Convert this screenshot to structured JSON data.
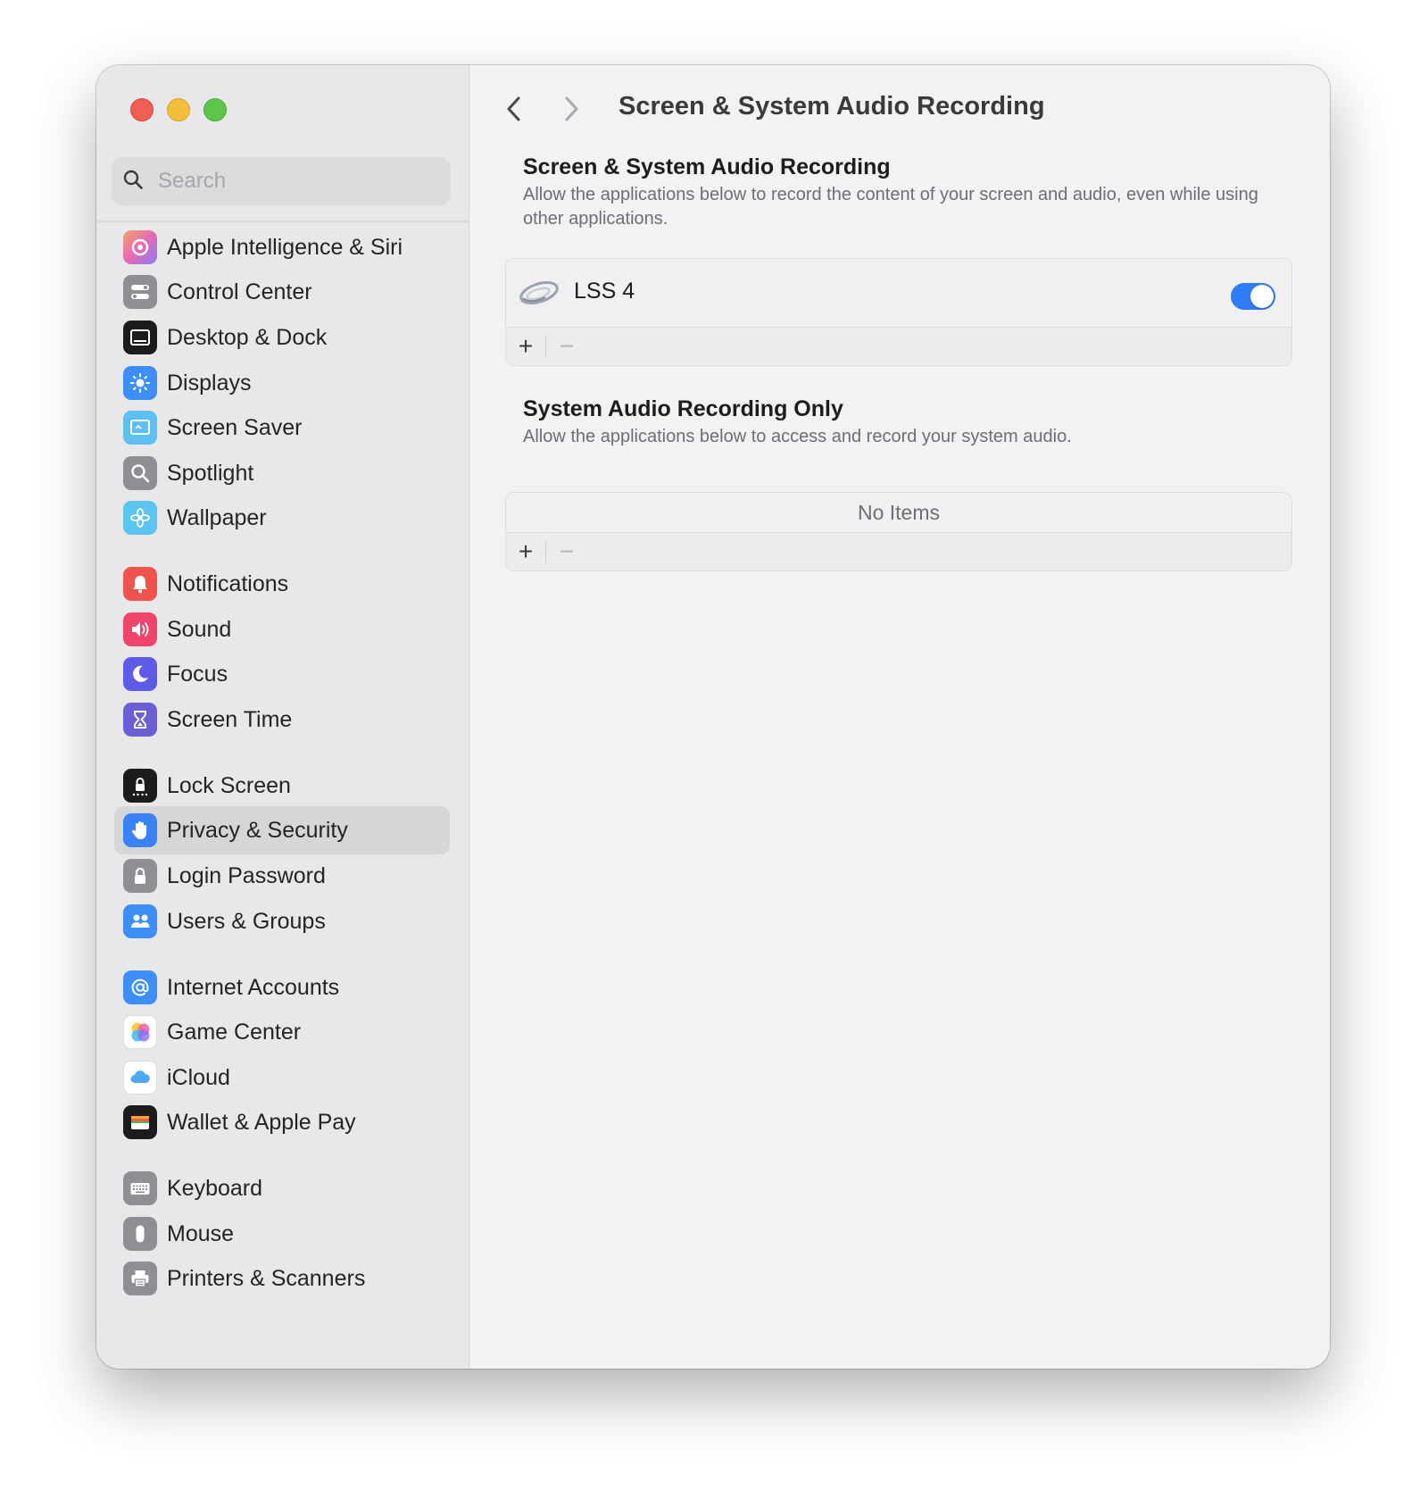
{
  "search": {
    "placeholder": "Search"
  },
  "sidebar": {
    "items": [
      {
        "label": "Apple Intelligence & Siri",
        "icon": "apple-intelligence-icon",
        "color": "#d97bd6"
      },
      {
        "label": "Control Center",
        "icon": "control-center-icon",
        "color": "#8e8e93"
      },
      {
        "label": "Desktop & Dock",
        "icon": "desktop-dock-icon",
        "color": "#1c1c1e"
      },
      {
        "label": "Displays",
        "icon": "displays-icon",
        "color": "#3d8ef7"
      },
      {
        "label": "Screen Saver",
        "icon": "screen-saver-icon",
        "color": "#5ec0f0"
      },
      {
        "label": "Spotlight",
        "icon": "spotlight-icon",
        "color": "#8e8e93"
      },
      {
        "label": "Wallpaper",
        "icon": "wallpaper-icon",
        "color": "#5cc4ee"
      },
      {
        "label": "Notifications",
        "icon": "notifications-icon",
        "color": "#f0524d"
      },
      {
        "label": "Sound",
        "icon": "sound-icon",
        "color": "#f0456a"
      },
      {
        "label": "Focus",
        "icon": "focus-icon",
        "color": "#5e5ce6"
      },
      {
        "label": "Screen Time",
        "icon": "screen-time-icon",
        "color": "#6b5fd6"
      },
      {
        "label": "Lock Screen",
        "icon": "lock-screen-icon",
        "color": "#1c1c1e"
      },
      {
        "label": "Privacy & Security",
        "icon": "privacy-hand-icon",
        "color": "#3b82f6"
      },
      {
        "label": "Login Password",
        "icon": "login-password-icon",
        "color": "#8e8e93"
      },
      {
        "label": "Users & Groups",
        "icon": "users-groups-icon",
        "color": "#3d8ef7"
      },
      {
        "label": "Internet Accounts",
        "icon": "internet-accounts-icon",
        "color": "#3d8ef7"
      },
      {
        "label": "Game Center",
        "icon": "game-center-icon",
        "color": "#ffffff"
      },
      {
        "label": "iCloud",
        "icon": "icloud-icon",
        "color": "#ffffff"
      },
      {
        "label": "Wallet & Apple Pay",
        "icon": "wallet-icon",
        "color": "#1c1c1e"
      },
      {
        "label": "Keyboard",
        "icon": "keyboard-icon",
        "color": "#8e8e93"
      },
      {
        "label": "Mouse",
        "icon": "mouse-icon",
        "color": "#8e8e93"
      },
      {
        "label": "Printers & Scanners",
        "icon": "printer-icon",
        "color": "#8e8e93"
      }
    ],
    "selected": "Privacy & Security"
  },
  "main": {
    "title": "Screen & System Audio Recording",
    "section1": {
      "title": "Screen & System Audio Recording",
      "description": "Allow the applications below to record the content of your screen and audio, even while using other applications.",
      "apps": [
        {
          "name": "LSS 4",
          "enabled": true
        }
      ]
    },
    "section2": {
      "title": "System Audio Recording Only",
      "description": "Allow the applications below to access and record your system audio.",
      "empty_text": "No Items"
    },
    "add_label": "+",
    "remove_label": "−"
  },
  "colors": {
    "accent": "#2f7cf6",
    "selection": "#d6d6d9"
  }
}
